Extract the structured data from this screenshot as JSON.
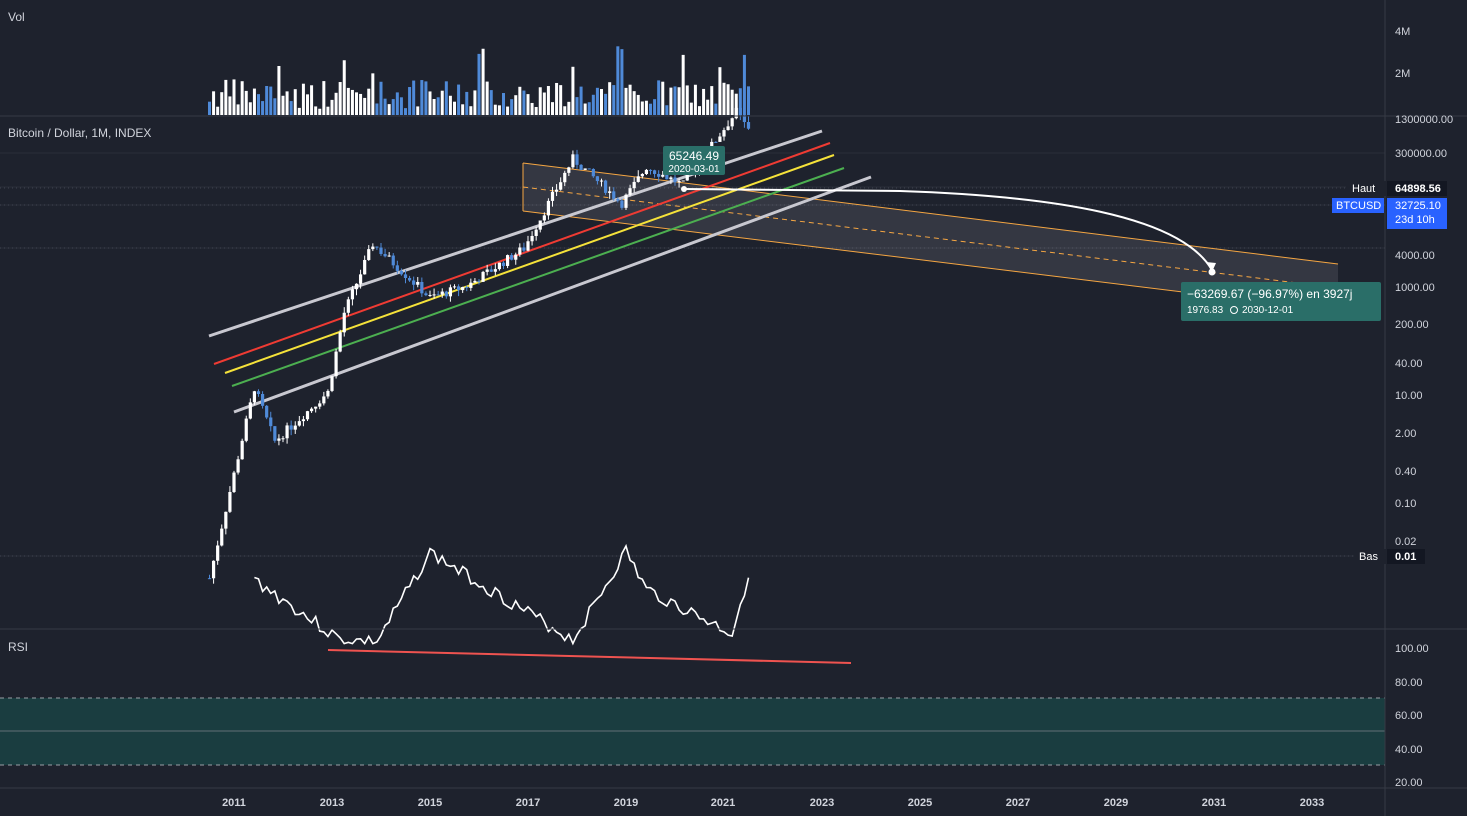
{
  "colors": {
    "background": "#1e222d",
    "grid": "#2a2e39",
    "candle_up": "#ffffff",
    "candle_down": "#4f8ad8",
    "vol_up": "#ffffff",
    "vol_down": "#4f8ad8",
    "channel_gray": "#c8c8d0",
    "channel_red": "#ef3b33",
    "channel_yellow": "#f5e23a",
    "channel_green": "#4caf50",
    "projection": "#f5a642",
    "rsi_line": "#ffffff",
    "rsi_trend": "#ef5350",
    "rsi_band": "#1a3d40",
    "teal_tag": "#2a6e68",
    "blue_tag": "#2962ff"
  },
  "volume_pane": {
    "title": "Vol",
    "axis": [
      "4M",
      "2M"
    ]
  },
  "price_pane": {
    "title": "Bitcoin / Dollar, 1M, INDEX",
    "axis": [
      "1300000.00",
      "300000.00",
      "4000.00",
      "1000.00",
      "200.00",
      "40.00",
      "10.00",
      "2.00",
      "0.40",
      "0.10",
      "0.02"
    ],
    "high_label": "Haut",
    "high_value": "64898.56",
    "symbol": "BTCUSD",
    "last_price": "32725.10",
    "countdown": "23d 10h",
    "low_label": "Bas",
    "low_value": "0.01",
    "top_callout_price": "65246.49",
    "top_callout_date": "2020-03-01",
    "target_callout_main": "−63269.67 (−96.97%) en 3927j",
    "target_callout_price": "1976.83",
    "target_callout_date": "2030-12-01"
  },
  "rsi_pane": {
    "title": "RSI",
    "axis": [
      "100.00",
      "80.00",
      "60.00",
      "40.00",
      "20.00"
    ],
    "upper": 70,
    "lower": 30
  },
  "x_axis": [
    "2011",
    "2013",
    "2015",
    "2017",
    "2019",
    "2021",
    "2023",
    "2025",
    "2027",
    "2029",
    "2031",
    "2033"
  ],
  "chart_data": {
    "type": "candlestick",
    "symbol": "BTCUSD",
    "interval": "1M",
    "y_scale": "log",
    "x_range": [
      "2010-07",
      "2033-12"
    ],
    "y_range": [
      0.01,
      1300000
    ],
    "price_anchors": [
      {
        "date": "2010-07",
        "price": 0.05
      },
      {
        "date": "2011-06",
        "price": 15
      },
      {
        "date": "2011-11",
        "price": 3
      },
      {
        "date": "2012-12",
        "price": 13
      },
      {
        "date": "2013-04",
        "price": 140
      },
      {
        "date": "2013-11",
        "price": 1100
      },
      {
        "date": "2015-01",
        "price": 220
      },
      {
        "date": "2015-10",
        "price": 310
      },
      {
        "date": "2016-12",
        "price": 960
      },
      {
        "date": "2017-12",
        "price": 14000
      },
      {
        "date": "2018-12",
        "price": 3700
      },
      {
        "date": "2019-06",
        "price": 11000
      },
      {
        "date": "2020-03",
        "price": 6400
      },
      {
        "date": "2020-12",
        "price": 29000
      },
      {
        "date": "2021-04",
        "price": 57000
      },
      {
        "date": "2021-07",
        "price": 32725
      }
    ],
    "high": 64898.56,
    "low": 0.01,
    "last": 32725.1,
    "projection": {
      "from": {
        "date": "2021-04",
        "price": 65246.49
      },
      "to": {
        "date": "2030-12",
        "price": 1976.83
      },
      "change": -63269.67,
      "change_pct": -96.97,
      "days": 3927
    },
    "rsi": {
      "period": 14,
      "upper": 70,
      "lower": 30,
      "anchors": [
        {
          "date": "2011-06",
          "value": 60
        },
        {
          "date": "2013-03",
          "value": 96
        },
        {
          "date": "2013-12",
          "value": 97
        },
        {
          "date": "2015-01",
          "value": 44
        },
        {
          "date": "2017-12",
          "value": 96
        },
        {
          "date": "2019-01",
          "value": 43
        },
        {
          "date": "2019-06",
          "value": 66
        },
        {
          "date": "2021-03",
          "value": 92
        },
        {
          "date": "2021-07",
          "value": 57
        }
      ]
    }
  }
}
